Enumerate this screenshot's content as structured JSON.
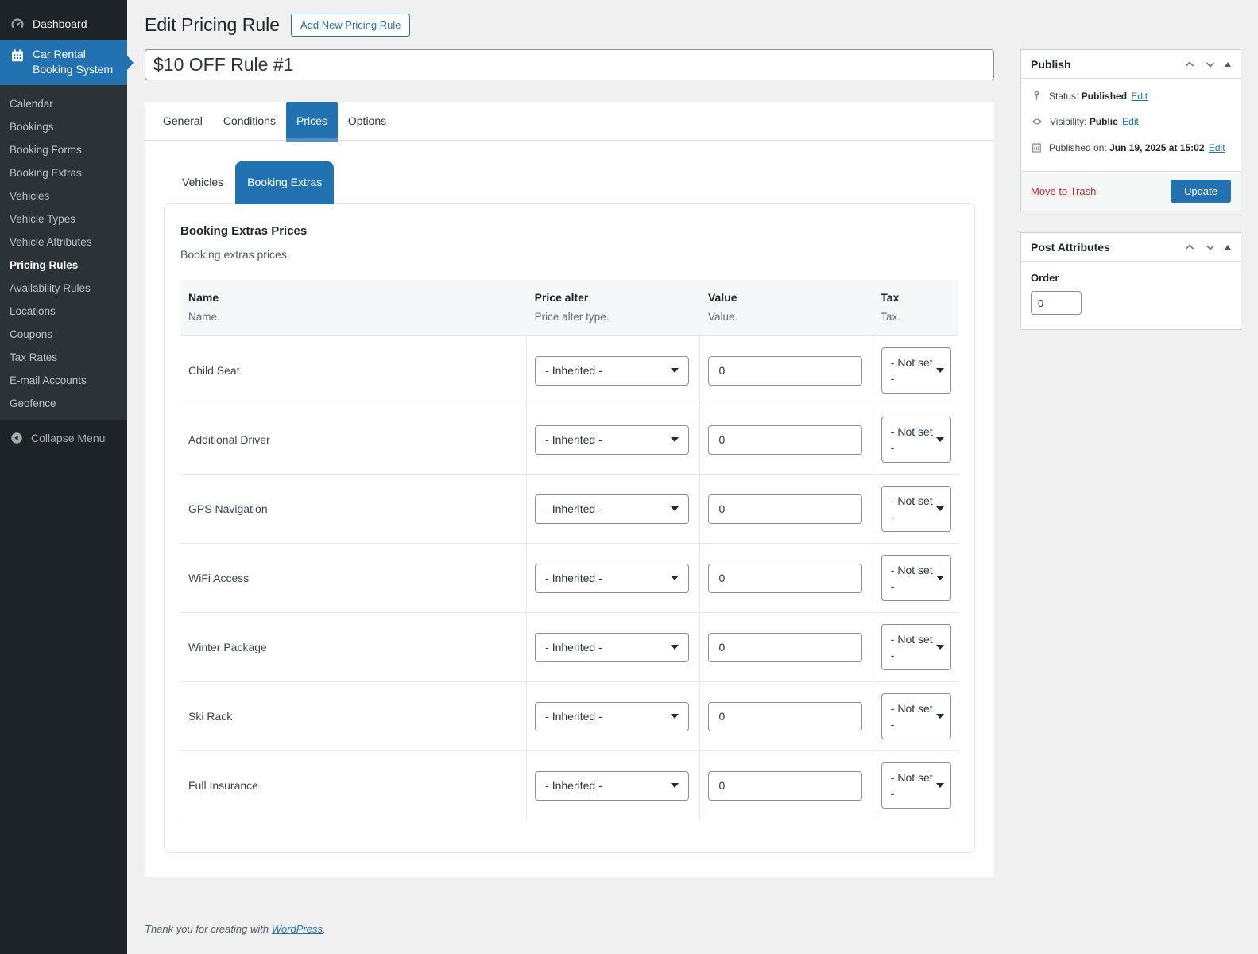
{
  "colors": {
    "accent": "#2271b1",
    "sidebar_bg": "#1d2327",
    "submenu_bg": "#2c3338",
    "trash_red": "#b32d2e"
  },
  "sidebar": {
    "dashboard_label": "Dashboard",
    "plugin_line1": "Car Rental",
    "plugin_line2": "Booking System",
    "items": [
      {
        "label": "Calendar",
        "active": false
      },
      {
        "label": "Bookings",
        "active": false
      },
      {
        "label": "Booking Forms",
        "active": false
      },
      {
        "label": "Booking Extras",
        "active": false
      },
      {
        "label": "Vehicles",
        "active": false
      },
      {
        "label": "Vehicle Types",
        "active": false
      },
      {
        "label": "Vehicle Attributes",
        "active": false
      },
      {
        "label": "Pricing Rules",
        "active": true
      },
      {
        "label": "Availability Rules",
        "active": false
      },
      {
        "label": "Locations",
        "active": false
      },
      {
        "label": "Coupons",
        "active": false
      },
      {
        "label": "Tax Rates",
        "active": false
      },
      {
        "label": "E-mail Accounts",
        "active": false
      },
      {
        "label": "Geofence",
        "active": false
      }
    ],
    "collapse_label": "Collapse Menu"
  },
  "header": {
    "title": "Edit Pricing Rule",
    "add_new_label": "Add New Pricing Rule"
  },
  "title_input": {
    "value": "$10 OFF Rule #1"
  },
  "tabs": [
    {
      "label": "General",
      "active": false
    },
    {
      "label": "Conditions",
      "active": false
    },
    {
      "label": "Prices",
      "active": true
    },
    {
      "label": "Options",
      "active": false
    }
  ],
  "subtabs": [
    {
      "label": "Vehicles",
      "active": false
    },
    {
      "label": "Booking Extras",
      "active": true
    }
  ],
  "section": {
    "heading": "Booking Extras Prices",
    "description": "Booking extras prices."
  },
  "table": {
    "columns": [
      {
        "label": "Name",
        "sublabel": "Name."
      },
      {
        "label": "Price alter",
        "sublabel": "Price alter type."
      },
      {
        "label": "Value",
        "sublabel": "Value."
      },
      {
        "label": "Tax",
        "sublabel": "Tax."
      }
    ],
    "rows": [
      {
        "name": "Child Seat",
        "price_alter": "- Inherited -",
        "value": "0",
        "tax": "- Not set -"
      },
      {
        "name": "Additional Driver",
        "price_alter": "- Inherited -",
        "value": "0",
        "tax": "- Not set -"
      },
      {
        "name": "GPS Navigation",
        "price_alter": "- Inherited -",
        "value": "0",
        "tax": "- Not set -"
      },
      {
        "name": "WiFi Access",
        "price_alter": "- Inherited -",
        "value": "0",
        "tax": "- Not set -"
      },
      {
        "name": "Winter Package",
        "price_alter": "- Inherited -",
        "value": "0",
        "tax": "- Not set -"
      },
      {
        "name": "Ski Rack",
        "price_alter": "- Inherited -",
        "value": "0",
        "tax": "- Not set -"
      },
      {
        "name": "Full Insurance",
        "price_alter": "- Inherited -",
        "value": "0",
        "tax": "- Not set -"
      }
    ]
  },
  "publish": {
    "title": "Publish",
    "status": {
      "label": "Status:",
      "value": "Published",
      "edit": "Edit"
    },
    "visibility": {
      "label": "Visibility:",
      "value": "Public",
      "edit": "Edit"
    },
    "published_on": {
      "label": "Published on:",
      "value": "Jun 19, 2025 at 15:02",
      "edit": "Edit"
    },
    "move_to_trash": "Move to Trash",
    "update": "Update"
  },
  "post_attributes": {
    "title": "Post Attributes",
    "order_label": "Order",
    "order_value": "0"
  },
  "footer": {
    "text": "Thank you for creating with ",
    "link": "WordPress",
    "period": "."
  }
}
